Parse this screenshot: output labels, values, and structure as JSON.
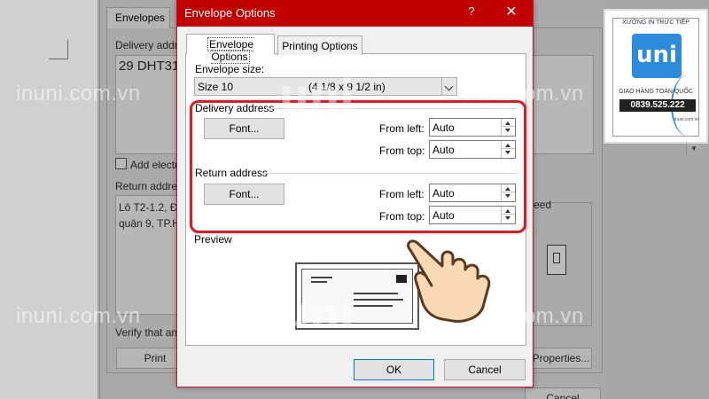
{
  "watermarks": {
    "text": "inuni.com.vn",
    "logo_mark": "uni"
  },
  "envelopes_dialog": {
    "tab_label": "Envelopes",
    "delivery_label": "Delivery addre",
    "delivery_value": "29 DHT31,",
    "add_electronic_label": "Add electro",
    "return_label": "Return address",
    "return_lines": [
      "Lô T2-1.2, Đ",
      "quận 9, TP.H"
    ],
    "feed_label": "eed",
    "verify_label": "Verify that an e",
    "print_button": "Print",
    "properties_button": "Properties...",
    "cancel_button": "Cancel"
  },
  "envelope_options": {
    "title": "Envelope Options",
    "help": "?",
    "close": "✕",
    "tabs": [
      {
        "label": "Envelope Options",
        "active": true
      },
      {
        "label": "Printing Options",
        "active": false
      }
    ],
    "size_label": "Envelope size:",
    "size_value": "Size 10",
    "size_dims": "(4 1/8 x 9 1/2 in)",
    "delivery": {
      "heading": "Delivery address",
      "font_button": "Font...",
      "from_left_label": "From left:",
      "from_left_value": "Auto",
      "from_top_label": "From top:",
      "from_top_value": "Auto"
    },
    "return": {
      "heading": "Return address",
      "font_button": "Font...",
      "from_left_label": "From left:",
      "from_left_value": "Auto",
      "from_top_label": "From top:",
      "from_top_value": "Auto"
    },
    "preview_label": "Preview",
    "ok_button": "OK",
    "cancel_button": "Cancel"
  },
  "badge": {
    "top_text": "XƯỞNG IN TRỰC TIẾP",
    "logo": "uni",
    "ship_text": "GIAO HÀNG TOÀN QUỐC",
    "phone": "0839.525.222",
    "site": "inuni.com.vn"
  },
  "colors": {
    "titlebar": "#c00000",
    "highlight": "#d0202a",
    "badge_blue": "#2d8bdc"
  }
}
